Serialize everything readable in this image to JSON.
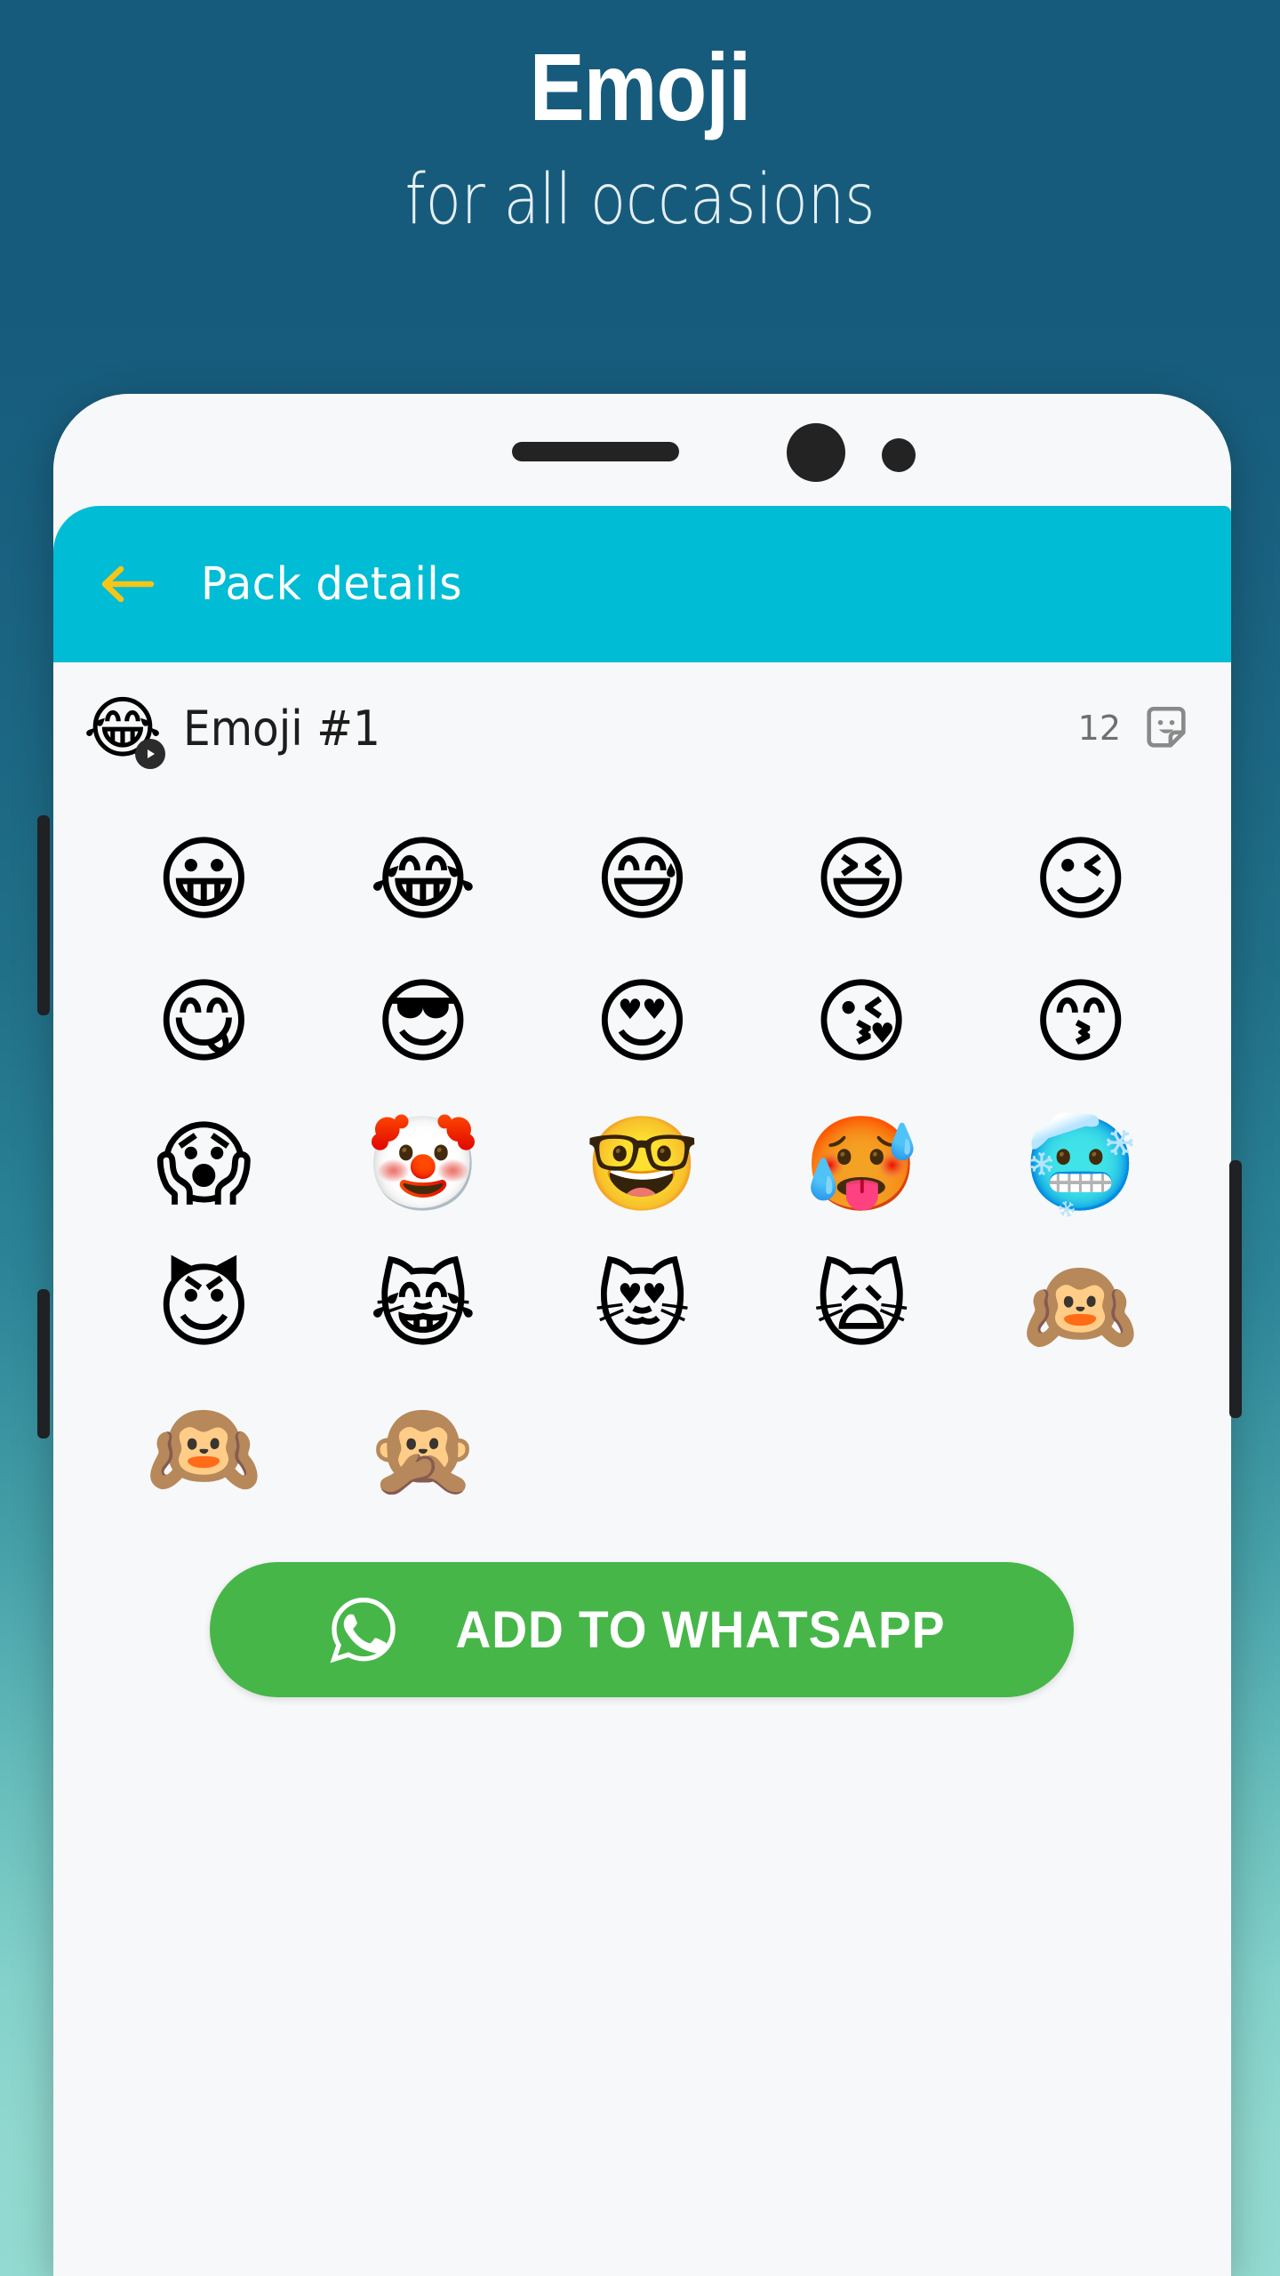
{
  "hero": {
    "title": "Emoji",
    "subtitle": "for all occasions"
  },
  "colors": {
    "background_top": "#175b7c",
    "background_bottom": "#93dbd2",
    "appbar": "#00bcd4",
    "back_arrow": "#f5c518",
    "cta_green": "#46b648",
    "screen": "#f7f8f9",
    "text_dark": "#1d1d1d",
    "text_muted": "#6f6f6f"
  },
  "device": {
    "speaker_name": "earpiece-speaker",
    "camera_large_name": "front-camera",
    "camera_small_name": "proximity-sensor",
    "buttons": [
      "volume-up",
      "volume-down",
      "power"
    ]
  },
  "appbar": {
    "back_icon": "arrow-left-icon",
    "title": "Pack details"
  },
  "pack": {
    "tray_emoji": "😂",
    "tray_badge_icon": "play-badge-icon",
    "name": "Emoji #1",
    "count": "12",
    "count_icon": "sticker-icon"
  },
  "grid": {
    "columns": 5,
    "stickers": [
      {
        "emoji": "😀",
        "name": "grinning-face"
      },
      {
        "emoji": "😂",
        "name": "face-with-tears-of-joy"
      },
      {
        "emoji": "😅",
        "name": "grinning-face-with-sweat"
      },
      {
        "emoji": "😆",
        "name": "grinning-squinting-face"
      },
      {
        "emoji": "😉",
        "name": "winking-face"
      },
      {
        "emoji": "😋",
        "name": "face-savoring-food"
      },
      {
        "emoji": "😎",
        "name": "smiling-face-with-sunglasses"
      },
      {
        "emoji": "😍",
        "name": "smiling-face-with-heart-eyes"
      },
      {
        "emoji": "😘",
        "name": "face-blowing-a-kiss"
      },
      {
        "emoji": "😙",
        "name": "kissing-smiling-face"
      },
      {
        "emoji": "😱",
        "name": "face-screaming-in-fear"
      },
      {
        "emoji": "🤡",
        "name": "clown-face"
      },
      {
        "emoji": "🤓",
        "name": "nerd-face"
      },
      {
        "emoji": "🥵",
        "name": "hot-face"
      },
      {
        "emoji": "🥶",
        "name": "cold-face"
      },
      {
        "emoji": "😈",
        "name": "smiling-face-with-horns"
      },
      {
        "emoji": "😹",
        "name": "cat-with-tears-of-joy"
      },
      {
        "emoji": "😻",
        "name": "smiling-cat-with-heart-eyes"
      },
      {
        "emoji": "🙀",
        "name": "weary-cat"
      },
      {
        "emoji": "🙉",
        "name": "hear-no-evil-monkey"
      },
      {
        "emoji": "🙉",
        "name": "hear-no-evil-monkey"
      },
      {
        "emoji": "🙊",
        "name": "speak-no-evil-monkey"
      }
    ]
  },
  "cta": {
    "label": "ADD TO WHATSAPP",
    "icon": "whatsapp-icon"
  }
}
